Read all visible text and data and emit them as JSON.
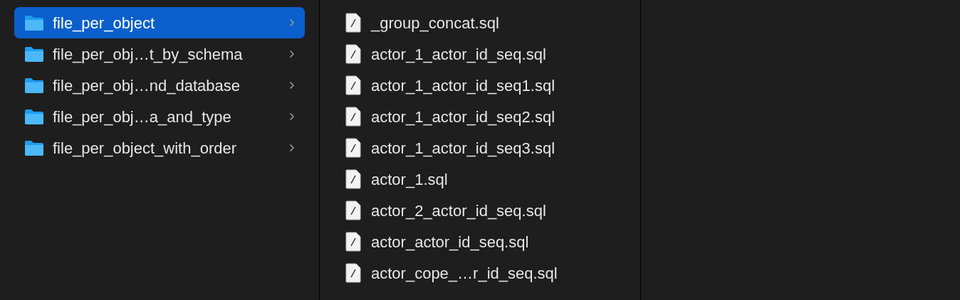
{
  "folders": [
    {
      "name": "file_per_object",
      "selected": true
    },
    {
      "name": "file_per_obj…t_by_schema",
      "selected": false
    },
    {
      "name": "file_per_obj…nd_database",
      "selected": false
    },
    {
      "name": "file_per_obj…a_and_type",
      "selected": false
    },
    {
      "name": "file_per_object_with_order",
      "selected": false
    }
  ],
  "files": [
    "_group_concat.sql",
    "actor_1_actor_id_seq.sql",
    "actor_1_actor_id_seq1.sql",
    "actor_1_actor_id_seq2.sql",
    "actor_1_actor_id_seq3.sql",
    "actor_1.sql",
    "actor_2_actor_id_seq.sql",
    "actor_actor_id_seq.sql",
    "actor_cope_…r_id_seq.sql"
  ]
}
